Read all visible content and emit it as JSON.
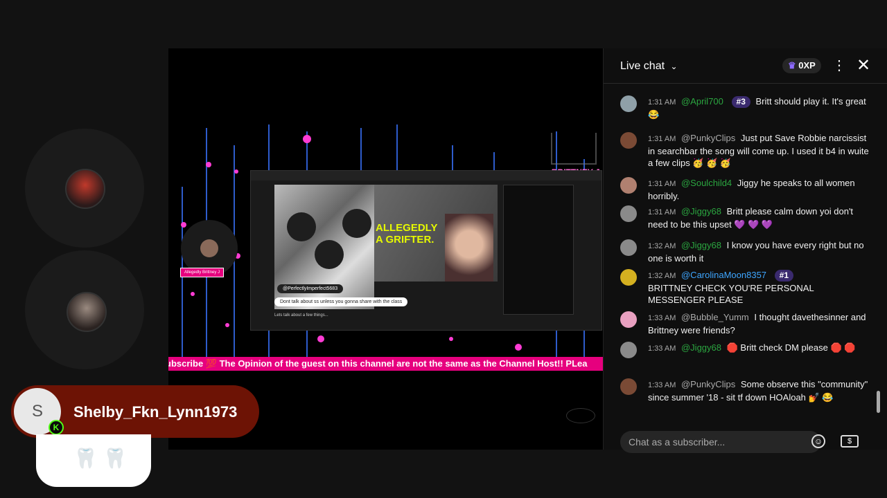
{
  "participants": [
    {
      "avatar_icon": "dark-warrior-avatar"
    },
    {
      "avatar_icon": "skull-armor-avatar"
    }
  ],
  "video": {
    "ticker_text": "ubscribe 💯 The Opinion of the guest on this channel are not the same as the Channel Host!! PLea",
    "watermark_text": "BRITTNEY J",
    "host_tag": "Allegedly Brittney J",
    "screen": {
      "headline_line1": "ALLEGEDLY",
      "headline_line2": "A GRIFTER.",
      "callout_user": "@PerfectlyImperfect5683",
      "callout_text": "Dont talk about ss unless you gonna share with the class",
      "caption": "Lets talk about a few things..."
    }
  },
  "chat": {
    "title": "Live chat",
    "xp_label": "0XP",
    "input_placeholder": "Chat as a subscriber...",
    "messages": [
      {
        "time": "1:31 AM",
        "author": "@April700",
        "rank": "#3",
        "text": "Britt should play it. It's great 😂",
        "avatar_color": "#8fa0a8"
      },
      {
        "time": "1:31 AM",
        "author": "@PunkyClips",
        "text": "Just put Save Robbie narcissist in searchbar the song will come up. I used it b4 in wuite a few clips 🥳 🥳 🥳",
        "avatar_color": "#7a4a35",
        "grey": true
      },
      {
        "time": "1:31 AM",
        "author": "@Soulchild4",
        "text": "Jiggy he speaks to all women horribly.",
        "avatar_color": "#b08070"
      },
      {
        "time": "1:31 AM",
        "author": "@Jiggy68",
        "text": "Britt please calm down yoi don't need to be this upset 💜 💜 💜",
        "avatar_color": "#8a8a8a"
      },
      {
        "time": "1:32 AM",
        "author": "@Jiggy68",
        "text": "I know you have every right but no one is worth it",
        "avatar_color": "#8a8a8a"
      },
      {
        "time": "1:32 AM",
        "author": "@CarolinaMoon8357",
        "rank": "#1",
        "text": "BRITTNEY CHECK YOU'RE PERSONAL MESSENGER PLEASE",
        "avatar_color": "#d4b020",
        "blue": true
      },
      {
        "time": "1:33 AM",
        "author": "@Bubble_Yumm",
        "text": "I thought davethesinner and Brittney were friends?",
        "avatar_color": "#e8a0c0",
        "grey": true
      },
      {
        "time": "1:33 AM",
        "author": "@Jiggy68",
        "text": "🛑 Britt check DM please 🛑 🛑",
        "avatar_color": "#8a8a8a"
      },
      {
        "time": "1:33 AM",
        "author": "@PunkyClips",
        "text": "Some observe this \"community\" since summer '18 - sit tf down HOAloah 💅 😂",
        "avatar_color": "#7a4a35",
        "grey": true
      }
    ]
  },
  "nametag": {
    "initial": "S",
    "name": "Shelby_Fkn_Lynn1973",
    "badge_letter": "K",
    "emojis": "🦷 🦷"
  }
}
